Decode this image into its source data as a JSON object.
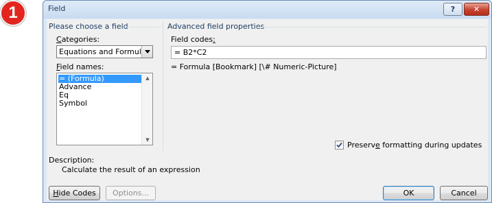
{
  "step_badge": "1",
  "window": {
    "title": "Field",
    "help_label": "?",
    "close_label": "✕"
  },
  "left_panel": {
    "heading": "Please choose a field",
    "categories_label": "Categories:",
    "categories_value": "Equations and Formulas",
    "field_names_label": "Field names:",
    "field_names": [
      "= (Formula)",
      "Advance",
      "Eq",
      "Symbol"
    ],
    "selected_index": 0
  },
  "right_panel": {
    "heading": "Advanced field properties",
    "field_codes_label": "Field codes:",
    "field_codes_value": "= B2*C2",
    "syntax_hint": "= Formula [Bookmark] [\\# Numeric-Picture]",
    "preserve_label": "Preserve formatting during updates",
    "preserve_checked": true
  },
  "description": {
    "label": "Description:",
    "text": "Calculate the result of an expression"
  },
  "buttons": {
    "hide_codes": "Hide Codes",
    "options": "Options...",
    "ok": "OK",
    "cancel": "Cancel"
  },
  "icons": {
    "dropdown": "chevron-down-icon",
    "check": "checkmark-icon"
  }
}
